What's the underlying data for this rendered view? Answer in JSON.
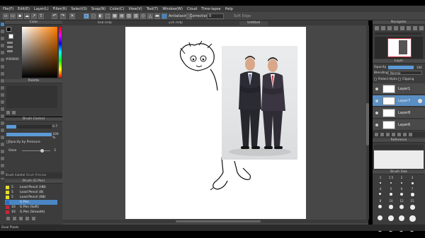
{
  "menu": [
    "File(F)",
    "Edit(E)",
    "Layer(L)",
    "Filter(R)",
    "Select(S)",
    "Snap(N)",
    "Color(C)",
    "View(V)",
    "Tool(T)",
    "Window(W)",
    "Cloud",
    "Time-lapse",
    "Help"
  ],
  "toolbar": {
    "antialiasing_label": "Antialiasing",
    "correction_label": "Correction",
    "correction_value": "0",
    "soft_edge_label": "Soft Edge"
  },
  "tabs": [
    "bob.mdp",
    "yuh.mdp",
    "Untitled"
  ],
  "color_panel": {
    "title": "Color",
    "hex": "#000000"
  },
  "palette_panel": {
    "title": "Palette"
  },
  "brush_control": {
    "title": "Brush Control",
    "size_value": "0.7",
    "opacity_value": "100 %",
    "opacity_pressure_label": "Opacity by Pressure",
    "ooze_label": "Ooze",
    "ooze_value": "3"
  },
  "lower_tabs": [
    "Brush Control",
    "Brush Preview"
  ],
  "brush_list": {
    "title": "Brush (G Pen)",
    "items": [
      {
        "num": "5",
        "name": "Lead Pencil (HB)",
        "color": "#e3dd2e"
      },
      {
        "num": "5",
        "name": "Lead Pencil (B)",
        "color": "#e3dd2e"
      },
      {
        "num": "5",
        "name": "Lead Pencil (6B)",
        "color": "#e3dd2e"
      },
      {
        "num": "",
        "name": "G Pen",
        "color": "#2a6fc0"
      },
      {
        "num": "10",
        "name": "G Pen (Soft)",
        "color": "#c7283d"
      },
      {
        "num": "10",
        "name": "G Pen (Smooth)",
        "color": "#c7283d"
      }
    ]
  },
  "navigator": {
    "title": "Navigator"
  },
  "layer_panel": {
    "title": "Layer",
    "opacity_label": "Opacity",
    "opacity_value": "100",
    "blending_label": "Blending",
    "blending_value": "Normal",
    "protect_alpha_label": "Protect Alpha",
    "clipping_label": "Clipping",
    "layers": [
      "Layer1",
      "Layer7",
      "Layer8",
      "Layer6"
    ]
  },
  "reference": {
    "title": "Reference"
  },
  "brush_size": {
    "title": "Brush Size",
    "numbers": [
      "1",
      "1.5",
      "2",
      "3",
      "4",
      "5",
      "6",
      "7",
      "8",
      "10",
      "12",
      "15"
    ]
  },
  "status": {
    "text": "Dual Pixels"
  }
}
